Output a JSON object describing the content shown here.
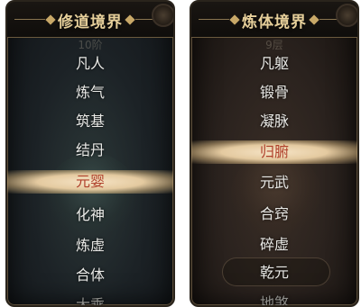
{
  "left_panel": {
    "title": "修道境界",
    "subtitle": "10阶",
    "items": [
      "凡人",
      "炼气",
      "筑基",
      "结丹",
      "元婴",
      "化神",
      "炼虚",
      "合体",
      "大乘"
    ],
    "selected_index": 4
  },
  "right_panel": {
    "title": "炼体境界",
    "subtitle": "9层",
    "items": [
      "凡躯",
      "锻骨",
      "凝脉",
      "归腑",
      "元武",
      "合窍",
      "碎虚",
      "乾元",
      "地煞"
    ],
    "selected_index": 3
  },
  "colors": {
    "title_gold": "#e6cf9a",
    "selected_text": "#b0412c",
    "item_text": "#e9e9e6"
  }
}
